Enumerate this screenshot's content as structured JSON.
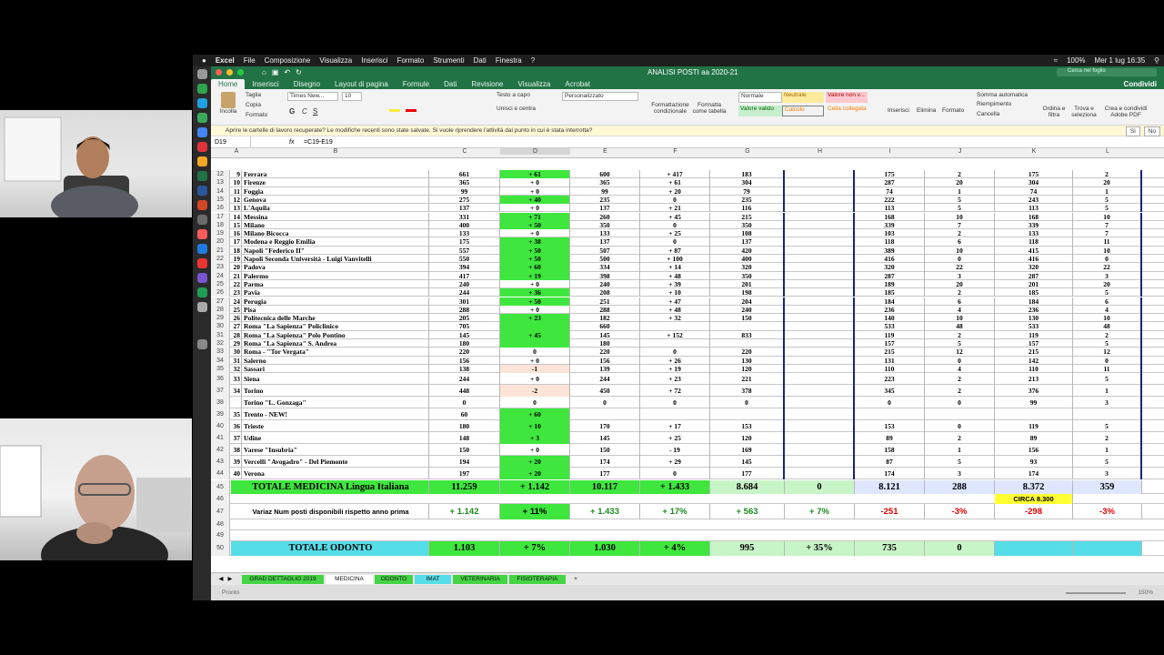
{
  "menubar": {
    "app": "Excel",
    "items": [
      "File",
      "Composizione",
      "Visualizza",
      "Inserisci",
      "Formato",
      "Strumenti",
      "Dati",
      "Finestra",
      "?"
    ],
    "battery": "100%",
    "datetime": "Mer 1 lug  16:35"
  },
  "window": {
    "title": "ANALISI POSTI aa 2020-21",
    "search_placeholder": "Cerca nel foglio"
  },
  "ribbon": {
    "tabs": [
      "Home",
      "Inserisci",
      "Disegno",
      "Layout di pagina",
      "Formule",
      "Dati",
      "Revisione",
      "Visualizza",
      "Acrobat"
    ],
    "share": "Condividi",
    "paste": "Incolla",
    "cut": "Taglia",
    "copy": "Copia",
    "format": "Formato",
    "font_name": "Times New...",
    "font_size": "10",
    "wrap": "Testo a capo",
    "merge": "Unisci e centra",
    "number_format": "Personalizzato",
    "cond_format": "Formattazione condizionale",
    "table_format": "Formatta come tabella",
    "styles": [
      "Normale",
      "Neutrale",
      "Valore non v...",
      "Valore valido",
      "Calcolo",
      "Cella collegata"
    ],
    "insert": "Inserisci",
    "delete": "Elimina",
    "format_cells": "Formato",
    "autosum": "Somma automatica",
    "fill": "Riempimento",
    "clear": "Cancella",
    "sort": "Ordina e filtra",
    "find": "Trova e seleziona",
    "pdf": "Crea e condividi Adobe PDF"
  },
  "notice": {
    "text": "Aprire le cartelle di lavoro recuperate?  Le modifiche recenti sono state salvate. Si vuole riprendere l'attività dal punto in cui è stata interrotta?",
    "yes": "Sì",
    "no": "No"
  },
  "formula_bar": {
    "cell_ref": "D19",
    "fx": "fx",
    "formula": "=C19-E19"
  },
  "columns": [
    "A",
    "B",
    "C",
    "D",
    "E",
    "F",
    "G",
    "H",
    "I",
    "J",
    "K",
    "L"
  ],
  "rows": [
    {
      "n": "12",
      "a": "9",
      "b": "Ferrara",
      "c": "661",
      "d": "+ 61",
      "e": "600",
      "f": "+ 417",
      "g": "183",
      "h": "",
      "i": "175",
      "j": "2",
      "k": "175",
      "l": "2"
    },
    {
      "n": "13",
      "a": "10",
      "b": "Firenze",
      "c": "365",
      "d": "+ 0",
      "e": "365",
      "f": "+ 61",
      "g": "304",
      "h": "",
      "i": "287",
      "j": "20",
      "k": "304",
      "l": "20"
    },
    {
      "n": "14",
      "a": "11",
      "b": "Foggia",
      "c": "99",
      "d": "+ 0",
      "e": "99",
      "f": "+ 20",
      "g": "79",
      "h": "",
      "i": "74",
      "j": "1",
      "k": "74",
      "l": "1"
    },
    {
      "n": "15",
      "a": "12",
      "b": "Genova",
      "c": "275",
      "d": "+ 40",
      "e": "235",
      "f": "0",
      "g": "235",
      "h": "",
      "i": "222",
      "j": "5",
      "k": "243",
      "l": "5"
    },
    {
      "n": "16",
      "a": "13",
      "b": "L'Aquila",
      "c": "137",
      "d": "+ 0",
      "e": "137",
      "f": "+ 21",
      "g": "116",
      "h": "",
      "i": "113",
      "j": "5",
      "k": "113",
      "l": "5"
    },
    {
      "n": "17",
      "a": "14",
      "b": "Messina",
      "c": "331",
      "d": "+ 71",
      "e": "260",
      "f": "+ 45",
      "g": "215",
      "h": "",
      "i": "168",
      "j": "10",
      "k": "168",
      "l": "10"
    },
    {
      "n": "18",
      "a": "15",
      "b": "Milano",
      "c": "400",
      "d": "+ 50",
      "e": "350",
      "f": "0",
      "g": "350",
      "h": "",
      "i": "339",
      "j": "7",
      "k": "339",
      "l": "7"
    },
    {
      "n": "19",
      "a": "16",
      "b": "Milano Bicocca",
      "c": "133",
      "d": "+ 0",
      "e": "133",
      "f": "+ 25",
      "g": "108",
      "h": "",
      "i": "103",
      "j": "2",
      "k": "133",
      "l": "7"
    },
    {
      "n": "20",
      "a": "17",
      "b": "Modena e Reggio Emilia",
      "c": "175",
      "d": "+ 38",
      "e": "137",
      "f": "0",
      "g": "137",
      "h": "",
      "i": "118",
      "j": "6",
      "k": "118",
      "l": "11"
    },
    {
      "n": "21",
      "a": "18",
      "b": "Napoli \"Federico II\"",
      "c": "557",
      "d": "+ 50",
      "e": "507",
      "f": "+ 87",
      "g": "420",
      "h": "",
      "i": "389",
      "j": "10",
      "k": "415",
      "l": "10"
    },
    {
      "n": "22",
      "a": "19",
      "b": "Napoli Seconda Università - Luigi Vanvitelli",
      "c": "550",
      "d": "+ 50",
      "e": "500",
      "f": "+ 100",
      "g": "400",
      "h": "",
      "i": "416",
      "j": "0",
      "k": "416",
      "l": "0"
    },
    {
      "n": "23",
      "a": "20",
      "b": "Padova",
      "c": "394",
      "d": "+ 60",
      "e": "334",
      "f": "+ 14",
      "g": "320",
      "h": "",
      "i": "320",
      "j": "22",
      "k": "320",
      "l": "22"
    },
    {
      "n": "24",
      "a": "21",
      "b": "Palermo",
      "c": "417",
      "d": "+ 19",
      "e": "398",
      "f": "+ 48",
      "g": "350",
      "h": "",
      "i": "287",
      "j": "3",
      "k": "287",
      "l": "3"
    },
    {
      "n": "25",
      "a": "22",
      "b": "Parma",
      "c": "240",
      "d": "+ 0",
      "e": "240",
      "f": "+ 39",
      "g": "201",
      "h": "",
      "i": "189",
      "j": "20",
      "k": "201",
      "l": "20"
    },
    {
      "n": "26",
      "a": "23",
      "b": "Pavia",
      "c": "244",
      "d": "+ 36",
      "e": "208",
      "f": "+ 10",
      "g": "198",
      "h": "",
      "i": "185",
      "j": "2",
      "k": "185",
      "l": "5"
    },
    {
      "n": "27",
      "a": "24",
      "b": "Perugia",
      "c": "301",
      "d": "+ 50",
      "e": "251",
      "f": "+ 47",
      "g": "204",
      "h": "",
      "i": "184",
      "j": "6",
      "k": "184",
      "l": "6"
    },
    {
      "n": "28",
      "a": "25",
      "b": "Pisa",
      "c": "288",
      "d": "+ 0",
      "e": "288",
      "f": "+ 48",
      "g": "240",
      "h": "",
      "i": "236",
      "j": "4",
      "k": "236",
      "l": "4"
    },
    {
      "n": "29",
      "a": "26",
      "b": "Politecnica delle Marche",
      "c": "205",
      "d": "+ 23",
      "e": "182",
      "f": "+ 32",
      "g": "150",
      "h": "",
      "i": "140",
      "j": "10",
      "k": "130",
      "l": "10"
    },
    {
      "n": "30",
      "a": "27",
      "b": "Roma  \"La Sapienza\"  Policlinico",
      "c": "705",
      "d": "",
      "e": "660",
      "f": "",
      "g": "",
      "h": "",
      "i": "533",
      "j": "48",
      "k": "533",
      "l": "48"
    },
    {
      "n": "31",
      "a": "28",
      "b": "Roma  \"La Sapienza\" Polo Pontino",
      "c": "145",
      "d": "+ 45",
      "e": "145",
      "f": "+ 152",
      "g": "833",
      "h": "",
      "i": "119",
      "j": "2",
      "k": "119",
      "l": "2"
    },
    {
      "n": "32",
      "a": "29",
      "b": "Roma  \"La Sapienza\"  S. Andrea",
      "c": "180",
      "d": "",
      "e": "180",
      "f": "",
      "g": "",
      "h": "",
      "i": "157",
      "j": "5",
      "k": "157",
      "l": "5"
    },
    {
      "n": "33",
      "a": "30",
      "b": "Roma - \"Tor Vergata\"",
      "c": "220",
      "d": "0",
      "e": "220",
      "f": "0",
      "g": "220",
      "h": "",
      "i": "215",
      "j": "12",
      "k": "215",
      "l": "12"
    },
    {
      "n": "34",
      "a": "31",
      "b": "Salerno",
      "c": "156",
      "d": "+ 0",
      "e": "156",
      "f": "+ 26",
      "g": "130",
      "h": "",
      "i": "131",
      "j": "0",
      "k": "142",
      "l": "0"
    },
    {
      "n": "35",
      "a": "32",
      "b": "Sassari",
      "c": "138",
      "d": "-1",
      "e": "139",
      "f": "+ 19",
      "g": "120",
      "h": "",
      "i": "110",
      "j": "4",
      "k": "110",
      "l": "11"
    },
    {
      "n": "36",
      "a": "33",
      "b": "Siena",
      "c": "244",
      "d": "+ 0",
      "e": "244",
      "f": "+ 23",
      "g": "221",
      "h": "",
      "i": "223",
      "j": "2",
      "k": "213",
      "l": "5"
    },
    {
      "n": "37",
      "a": "34",
      "b": "Torino",
      "c": "448",
      "d": "-2",
      "e": "450",
      "f": "+ 72",
      "g": "378",
      "h": "",
      "i": "345",
      "j": "2",
      "k": "376",
      "l": "1"
    },
    {
      "n": "38",
      "a": "",
      "b": "Torino \"L. Gonzaga\"",
      "c": "0",
      "d": "0",
      "e": "0",
      "f": "0",
      "g": "0",
      "h": "",
      "i": "0",
      "j": "0",
      "k": "99",
      "l": "3"
    },
    {
      "n": "39",
      "a": "35",
      "b": "Trento - NEW!",
      "c": "60",
      "d": "+ 60",
      "e": "",
      "f": "",
      "g": "",
      "h": "",
      "i": "",
      "j": "",
      "k": "",
      "l": ""
    },
    {
      "n": "40",
      "a": "36",
      "b": "Trieste",
      "c": "180",
      "d": "+ 10",
      "e": "170",
      "f": "+ 17",
      "g": "153",
      "h": "",
      "i": "153",
      "j": "0",
      "k": "119",
      "l": "5"
    },
    {
      "n": "41",
      "a": "37",
      "b": "Udine",
      "c": "148",
      "d": "+ 3",
      "e": "145",
      "f": "+ 25",
      "g": "120",
      "h": "",
      "i": "89",
      "j": "2",
      "k": "89",
      "l": "2"
    },
    {
      "n": "42",
      "a": "38",
      "b": "Varese \"Insubria\"",
      "c": "150",
      "d": "+ 0",
      "e": "150",
      "f": "- 19",
      "g": "169",
      "h": "",
      "i": "158",
      "j": "1",
      "k": "156",
      "l": "1"
    },
    {
      "n": "43",
      "a": "39",
      "b": "Vercelli \"Avogadro\" - Del Piemonte",
      "c": "194",
      "d": "+ 20",
      "e": "174",
      "f": "+ 29",
      "g": "145",
      "h": "",
      "i": "87",
      "j": "5",
      "k": "93",
      "l": "5"
    },
    {
      "n": "44",
      "a": "40",
      "b": "Verona",
      "c": "197",
      "d": "+ 20",
      "e": "177",
      "f": "0",
      "g": "177",
      "h": "",
      "i": "174",
      "j": "3",
      "k": "174",
      "l": "3"
    }
  ],
  "total_medicina": {
    "n": "45",
    "label": "TOTALE MEDICINA Lingua Italiana",
    "c": "11.259",
    "d": "+ 1.142",
    "e": "10.117",
    "f": "+ 1.433",
    "g": "8.684",
    "h": "0",
    "i": "8.121",
    "j": "288",
    "k": "8.372",
    "l": "359"
  },
  "circa": {
    "n": "46",
    "text": "CIRCA 8.300"
  },
  "variaz": {
    "n": "47",
    "label": "Variaz Num posti disponibili rispetto anno prima",
    "c": "+ 1.142",
    "d": "+ 11%",
    "e": "+ 1.433",
    "f": "+ 17%",
    "g": "+ 563",
    "h": "+ 7%",
    "i": "-251",
    "j": "-3%",
    "k": "-298",
    "l": "-3%"
  },
  "empty_rows": [
    "46",
    "48",
    "49"
  ],
  "total_odonto": {
    "n": "50",
    "label": "TOTALE ODONTO",
    "c": "1.103",
    "d": "+ 7%",
    "e": "1.030",
    "f": "+ 4%",
    "g": "995",
    "h": "+ 35%",
    "i": "735",
    "j": "0",
    "k": "",
    "l": ""
  },
  "sheets": [
    {
      "name": "GRAD DETTAGLIO 2019",
      "color": "#44d444"
    },
    {
      "name": "MEDICINA",
      "color": "#ffffff"
    },
    {
      "name": "ODONTO",
      "color": "#44d444"
    },
    {
      "name": "IMAT",
      "color": "#55dde8"
    },
    {
      "name": "VETERINARIA",
      "color": "#44d444"
    },
    {
      "name": "FISIOTERAPIA",
      "color": "#44d444"
    }
  ],
  "status": {
    "left": "Pronto",
    "zoom": "150%"
  },
  "colors": {
    "excel_green": "#217346",
    "bright_green": "#3ee63e",
    "light_green": "#c8f5c8",
    "cyan": "#55dde8",
    "yellow": "#ffff33",
    "navy": "#1a237e",
    "red": "#e00000"
  }
}
